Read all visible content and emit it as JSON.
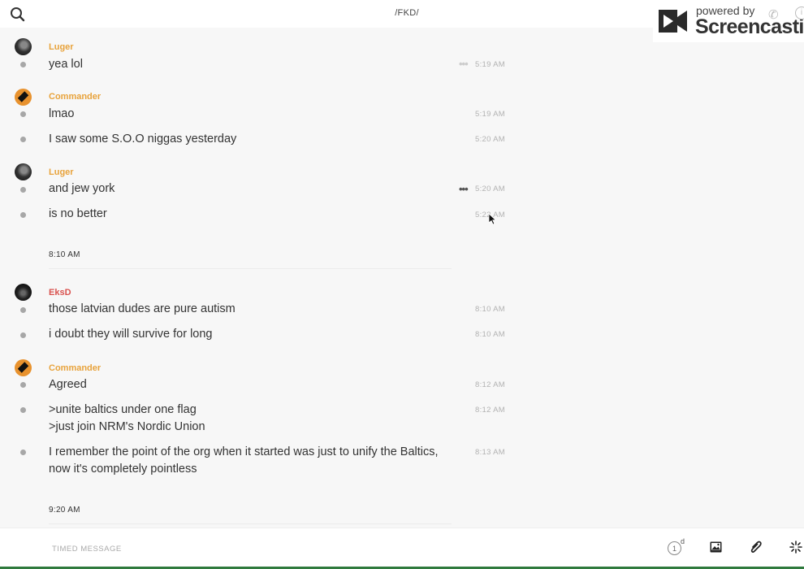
{
  "header": {
    "channel_name": "/FKD/"
  },
  "watermark": {
    "powered_by": "powered by",
    "brand": "Screencastify"
  },
  "messages": [
    {
      "user": "Luger",
      "user_color": "#e8a33c",
      "avatar": "luger",
      "lines": [
        {
          "text": "yea lol",
          "time": "5:19 AM"
        }
      ]
    },
    {
      "user": "Commander",
      "user_color": "#e8a33c",
      "avatar": "commander",
      "lines": [
        {
          "text": "lmao",
          "time": "5:19 AM"
        },
        {
          "text": "I saw some S.O.O niggas yesterday",
          "time": "5:20 AM"
        }
      ]
    },
    {
      "user": "Luger",
      "user_color": "#e8a33c",
      "avatar": "luger",
      "lines": [
        {
          "text": "and jew york",
          "time": "5:20 AM"
        },
        {
          "text": "is no better",
          "time": "5:22 AM"
        }
      ]
    },
    {
      "divider": "8:10 AM"
    },
    {
      "user": "EksD",
      "user_color": "#d9534f",
      "avatar": "eksd",
      "lines": [
        {
          "text": "those latvian dudes are pure autism",
          "time": "8:10 AM"
        },
        {
          "text": "i doubt they will survive for long",
          "time": "8:10 AM"
        }
      ]
    },
    {
      "user": "Commander",
      "user_color": "#e8a33c",
      "avatar": "commander",
      "lines": [
        {
          "text": "Agreed",
          "time": "8:12 AM"
        },
        {
          "text": ">unite baltics under one flag\n>just join NRM's Nordic Union",
          "time": "8:12 AM"
        },
        {
          "text": "I remember the point of the org when it started was just to unify the Baltics, now it's completely pointless",
          "time": "8:13 AM"
        }
      ]
    },
    {
      "divider": "9:20 AM"
    }
  ],
  "composer": {
    "placeholder": "TIMED MESSAGE",
    "timer_value": "1",
    "timer_unit": "d"
  },
  "icons": {
    "search": "search-icon",
    "more": "more-options-icon",
    "image": "image-icon",
    "attachment": "paperclip-icon",
    "burst": "burst-icon",
    "timer": "timer-icon"
  },
  "colors": {
    "background": "#f7f7f7",
    "username_orange": "#e8a33c",
    "username_red": "#d9534f",
    "bottom_strip": "#2f7a3e"
  }
}
